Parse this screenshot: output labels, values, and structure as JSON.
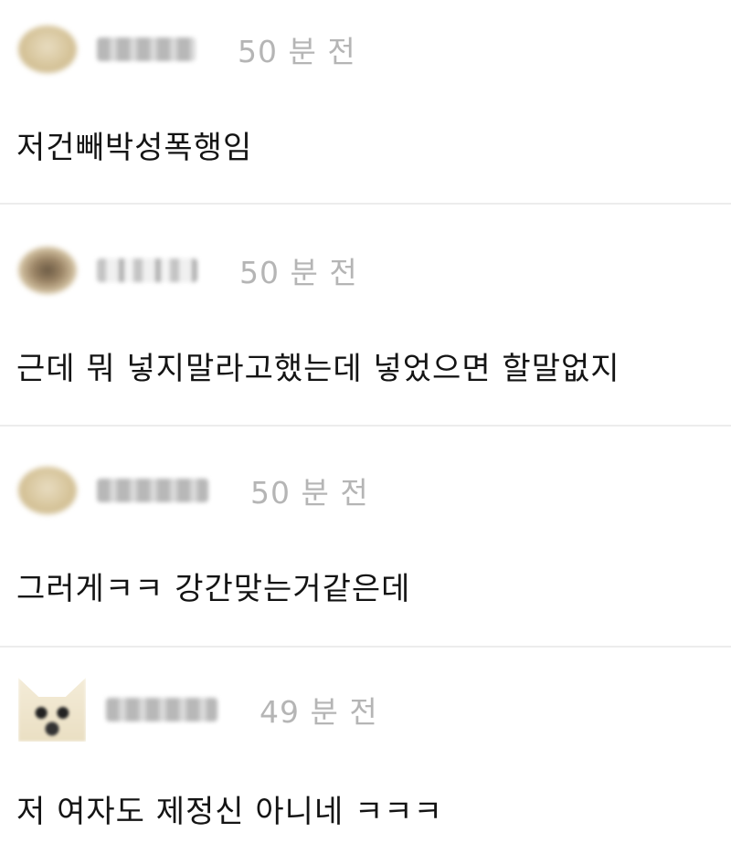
{
  "comments": [
    {
      "author": "",
      "time": "50 분 전",
      "text": "저건빼박성폭행임"
    },
    {
      "author": "",
      "time": "50 분 전",
      "text": "근데 뭐 넣지말라고했는데 넣었으면 할말없지"
    },
    {
      "author": "",
      "time": "50 분 전",
      "text": "그러게ㅋㅋ 강간맞는거같은데"
    },
    {
      "author": "",
      "time": "49 분 전",
      "text": "저 여자도 제정신 아니네 ㅋㅋㅋ"
    }
  ],
  "colors": {
    "time": "#b5b5b5",
    "text": "#141414",
    "divider": "#ececec",
    "background": "#ffffff"
  }
}
